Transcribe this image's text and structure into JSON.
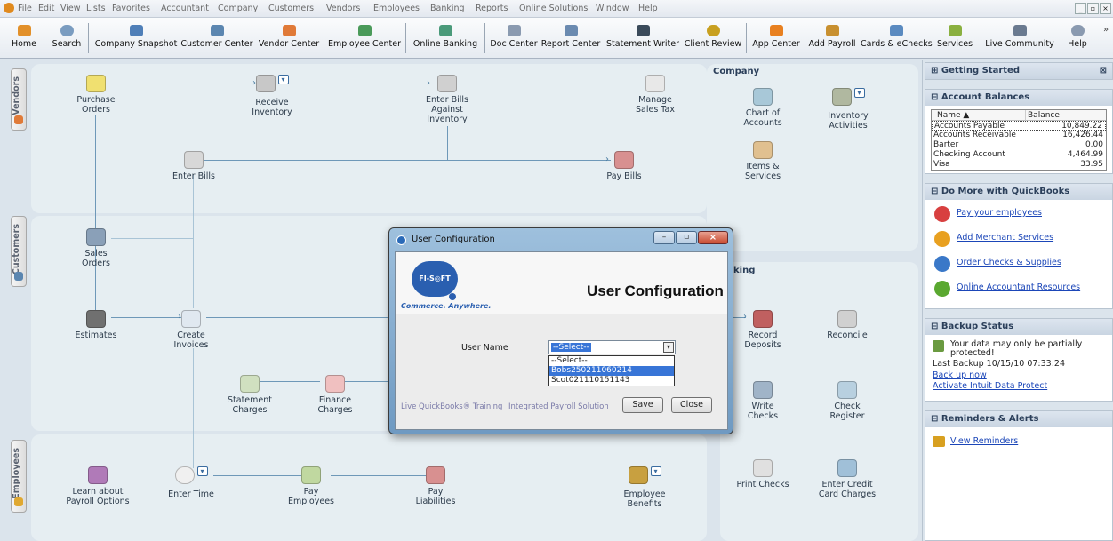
{
  "menu": [
    "File",
    "Edit",
    "View",
    "Lists",
    "Favorites",
    "Accountant",
    "Company",
    "Customers",
    "Vendors",
    "Employees",
    "Banking",
    "Reports",
    "Online Solutions",
    "Window",
    "Help"
  ],
  "toolbar": [
    "Home",
    "Search",
    "Company Snapshot",
    "Customer Center",
    "Vendor Center",
    "Employee Center",
    "Online Banking",
    "Doc Center",
    "Report Center",
    "Statement Writer",
    "Client Review",
    "App Center",
    "Add Payroll",
    "Cards & eChecks",
    "Services",
    "Live Community",
    "Help"
  ],
  "toolbar_overflow": "»",
  "tabs": {
    "vendors": "Vendors",
    "customers": "Customers",
    "employees": "Employees"
  },
  "vendors": {
    "purchase_orders": "Purchase Orders",
    "receive_inventory": "Receive Inventory",
    "enter_bills_against": "Enter Bills Against Inventory",
    "manage_sales_tax": "Manage Sales Tax",
    "enter_bills": "Enter Bills",
    "pay_bills": "Pay Bills"
  },
  "customers": {
    "sales_orders": "Sales Orders",
    "estimates": "Estimates",
    "create_invoices": "Create Invoices",
    "statement_charges": "Statement Charges",
    "finance_charges": "Finance Charges"
  },
  "employees": {
    "learn_payroll": "Learn about Payroll Options",
    "enter_time": "Enter Time",
    "pay_employees": "Pay Employees",
    "pay_liabilities": "Pay Liabilities",
    "employee_benefits": "Employee Benefits"
  },
  "company": {
    "title": "Company",
    "chart_of_accounts": "Chart of Accounts",
    "inventory_activities": "Inventory Activities",
    "items_services": "Items & Services"
  },
  "banking": {
    "title_partial": "king",
    "record_deposits": "Record Deposits",
    "reconcile": "Reconcile",
    "write_checks": "Write Checks",
    "check_register": "Check Register",
    "print_checks": "Print Checks",
    "enter_credit_card": "Enter Credit Card Charges"
  },
  "right": {
    "getting_started": "Getting Started",
    "account_balances": "Account Balances",
    "col_name": "Name",
    "col_balance": "Balance",
    "accounts": [
      {
        "name": "Accounts Payable",
        "balance": "10,849.22"
      },
      {
        "name": "Accounts Receivable",
        "balance": "16,426.44"
      },
      {
        "name": "Barter",
        "balance": "0.00"
      },
      {
        "name": "Checking Account",
        "balance": "4,464.99"
      },
      {
        "name": "Visa",
        "balance": "33.95"
      }
    ],
    "do_more": "Do More with QuickBooks",
    "links": [
      "Pay your employees",
      "Add Merchant Services",
      "Order Checks & Supplies",
      "Online Accountant Resources"
    ],
    "backup_status": "Backup Status",
    "backup_msg": "Your data may only be partially protected!",
    "last_backup": "Last Backup 10/15/10 07:33:24",
    "back_up_now": "Back up now",
    "activate": "Activate Intuit Data Protect",
    "reminders": "Reminders & Alerts",
    "view_reminders": "View Reminders"
  },
  "dialog": {
    "title": "User Configuration",
    "logo": "FI-S◎FT",
    "tagline": "Commerce. Anywhere.",
    "heading": "User Configuration",
    "user_label": "User Name",
    "selected": "--Select--",
    "options": [
      "--Select--",
      "Bobs250211060214",
      "Scot021110151143"
    ],
    "link1": "Live QuickBooks® Training",
    "link2": "Integrated Payroll Solutions",
    "save": "Save",
    "close": "Close"
  }
}
